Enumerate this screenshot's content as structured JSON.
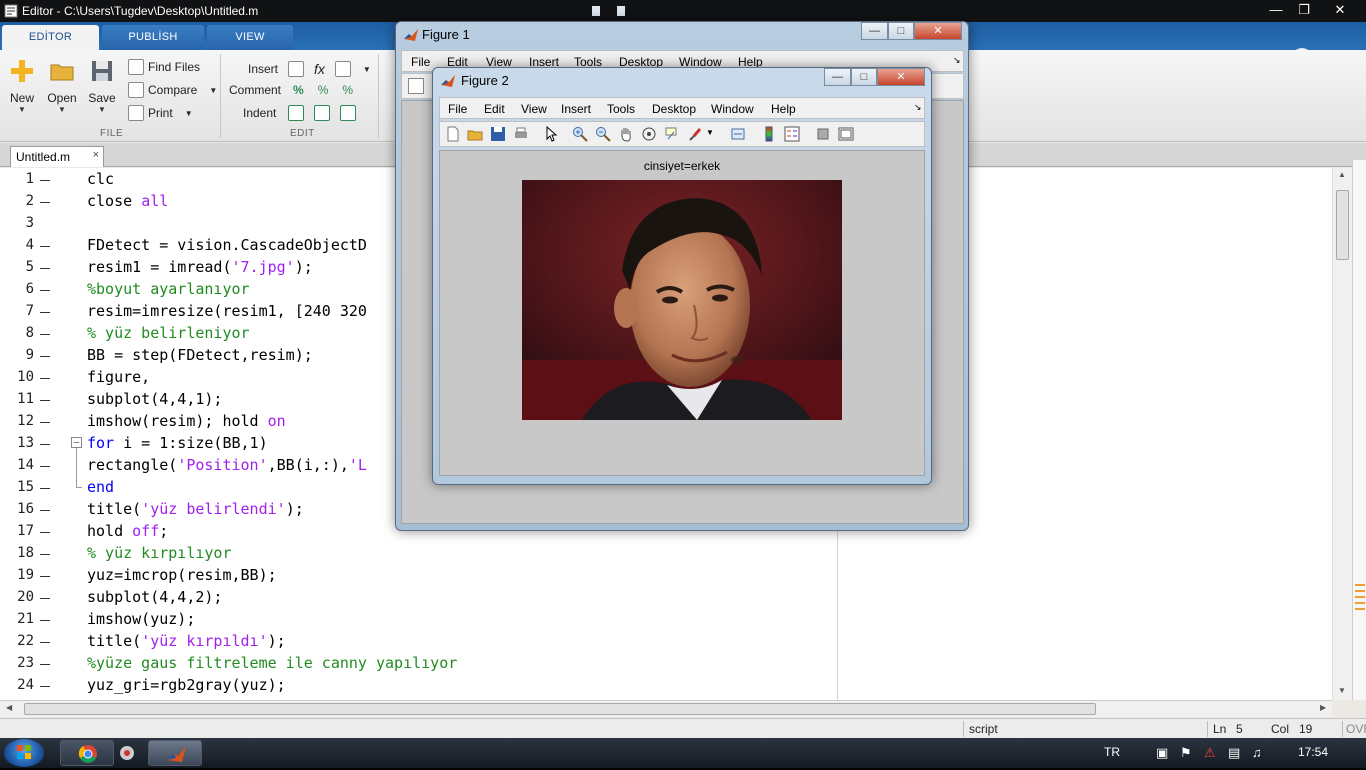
{
  "editor": {
    "window_title": "Editor - C:\\Users\\Tugdev\\Desktop\\Untitled.m",
    "ribbon_tabs": [
      "EDİTOR",
      "PUBLİSH",
      "VIEW"
    ],
    "file_group": {
      "new": "New",
      "open": "Open",
      "save": "Save",
      "find_files": "Find Files",
      "compare": "Compare",
      "print": "Print",
      "label": "FILE"
    },
    "edit_group": {
      "insert": "Insert",
      "comment": "Comment",
      "indent": "Indent",
      "label": "EDIT"
    },
    "doc_tab": "Untitled.m",
    "code_lines": [
      {
        "n": "1",
        "parts": [
          {
            "t": "clc",
            "c": ""
          }
        ]
      },
      {
        "n": "2",
        "parts": [
          {
            "t": "close ",
            "c": ""
          },
          {
            "t": "all",
            "c": "str"
          }
        ]
      },
      {
        "n": "3",
        "parts": []
      },
      {
        "n": "4",
        "parts": [
          {
            "t": "FDetect = vision.CascadeObjectD",
            "c": ""
          }
        ]
      },
      {
        "n": "5",
        "parts": [
          {
            "t": "resim1 = imread(",
            "c": ""
          },
          {
            "t": "'7.jpg'",
            "c": "str"
          },
          {
            "t": ");",
            "c": ""
          }
        ]
      },
      {
        "n": "6",
        "parts": [
          {
            "t": "%boyut ayarlanıyor",
            "c": "cmt"
          }
        ]
      },
      {
        "n": "7",
        "parts": [
          {
            "t": "resim=imresize(resim1, [240 320",
            "c": ""
          }
        ]
      },
      {
        "n": "8",
        "parts": [
          {
            "t": "% yüz belirleniyor",
            "c": "cmt"
          }
        ]
      },
      {
        "n": "9",
        "parts": [
          {
            "t": "BB = step(FDetect,resim);",
            "c": ""
          }
        ]
      },
      {
        "n": "10",
        "parts": [
          {
            "t": "figure,",
            "c": ""
          }
        ]
      },
      {
        "n": "11",
        "parts": [
          {
            "t": "subplot(4,4,1);",
            "c": ""
          }
        ]
      },
      {
        "n": "12",
        "parts": [
          {
            "t": "imshow(resim); hold ",
            "c": ""
          },
          {
            "t": "on",
            "c": "str"
          }
        ]
      },
      {
        "n": "13",
        "parts": [
          {
            "t": "for",
            "c": "kw"
          },
          {
            "t": " i = 1:size(BB,1)",
            "c": ""
          }
        ]
      },
      {
        "n": "14",
        "parts": [
          {
            "t": "rectangle(",
            "c": ""
          },
          {
            "t": "'Position'",
            "c": "str"
          },
          {
            "t": ",BB(i,:),",
            "c": ""
          },
          {
            "t": "'L",
            "c": "str"
          }
        ]
      },
      {
        "n": "15",
        "parts": [
          {
            "t": "end",
            "c": "kw"
          }
        ]
      },
      {
        "n": "16",
        "parts": [
          {
            "t": "title(",
            "c": ""
          },
          {
            "t": "'yüz belirlendi'",
            "c": "str"
          },
          {
            "t": ");",
            "c": ""
          }
        ]
      },
      {
        "n": "17",
        "parts": [
          {
            "t": "hold ",
            "c": ""
          },
          {
            "t": "off",
            "c": "str"
          },
          {
            "t": ";",
            "c": ""
          }
        ]
      },
      {
        "n": "18",
        "parts": [
          {
            "t": "% yüz kırpılıyor",
            "c": "cmt"
          }
        ]
      },
      {
        "n": "19",
        "parts": [
          {
            "t": "yuz=imcrop(resim,BB);",
            "c": ""
          }
        ]
      },
      {
        "n": "20",
        "parts": [
          {
            "t": "subplot(4,4,2);",
            "c": ""
          }
        ]
      },
      {
        "n": "21",
        "parts": [
          {
            "t": "imshow(yuz);",
            "c": ""
          }
        ]
      },
      {
        "n": "22",
        "parts": [
          {
            "t": "title(",
            "c": ""
          },
          {
            "t": "'yüz kırpıldı'",
            "c": "str"
          },
          {
            "t": ");",
            "c": ""
          }
        ]
      },
      {
        "n": "23",
        "parts": [
          {
            "t": "%yüze gaus filtreleme ile canny yapılıyor",
            "c": "cmt"
          }
        ]
      },
      {
        "n": "24",
        "parts": [
          {
            "t": "yuz_gri=rgb2gray(yuz);",
            "c": ""
          }
        ]
      }
    ],
    "status": {
      "mode": "script",
      "ln_label": "Ln",
      "ln_value": "5",
      "col_label": "Col",
      "col_value": "19",
      "ovr": "OVR"
    }
  },
  "figure1": {
    "title": "Figure 1",
    "menu": [
      "File",
      "Edit",
      "View",
      "Insert",
      "Tools",
      "Desktop",
      "Window",
      "Help"
    ]
  },
  "figure2": {
    "title": "Figure 2",
    "menu": [
      "File",
      "Edit",
      "View",
      "Insert",
      "Tools",
      "Desktop",
      "Window",
      "Help"
    ],
    "plot_title": "cinsiyet=erkek"
  },
  "taskbar": {
    "language": "TR",
    "clock": "17:54"
  }
}
